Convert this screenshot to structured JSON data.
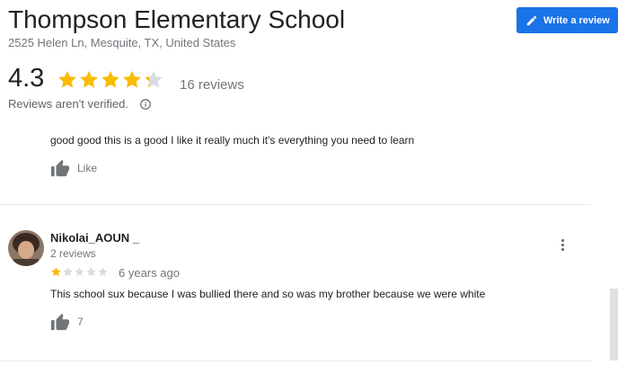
{
  "place": {
    "title": "Thompson Elementary School",
    "address": "2525 Helen Ln, Mesquite, TX, United States"
  },
  "actions": {
    "write_review_label": "Write a review"
  },
  "summary": {
    "rating": "4.3",
    "rating_value": 4.3,
    "stars_max": 5,
    "reviews_count": "16 reviews",
    "not_verified": "Reviews aren't verified."
  },
  "reviews": [
    {
      "text": "good good this is a good I like it really much it's everything you need to learn",
      "like_label": "Like"
    },
    {
      "author": "Nikolai_AOUN _",
      "author_reviews": "2 reviews",
      "rating_value": 1,
      "date": "6 years ago",
      "text": "This school sux because I was bullied there and so was my brother because we were white",
      "like_count": "7"
    }
  ],
  "colors": {
    "accent": "#1a73e8",
    "star_filled": "#fbbc04",
    "star_empty": "#dadce0",
    "like_icon": "#70757a"
  },
  "icons": {
    "write_review": "pencil-icon",
    "info": "info-icon",
    "like": "thumbs-up-icon",
    "more": "more-vert-icon"
  }
}
